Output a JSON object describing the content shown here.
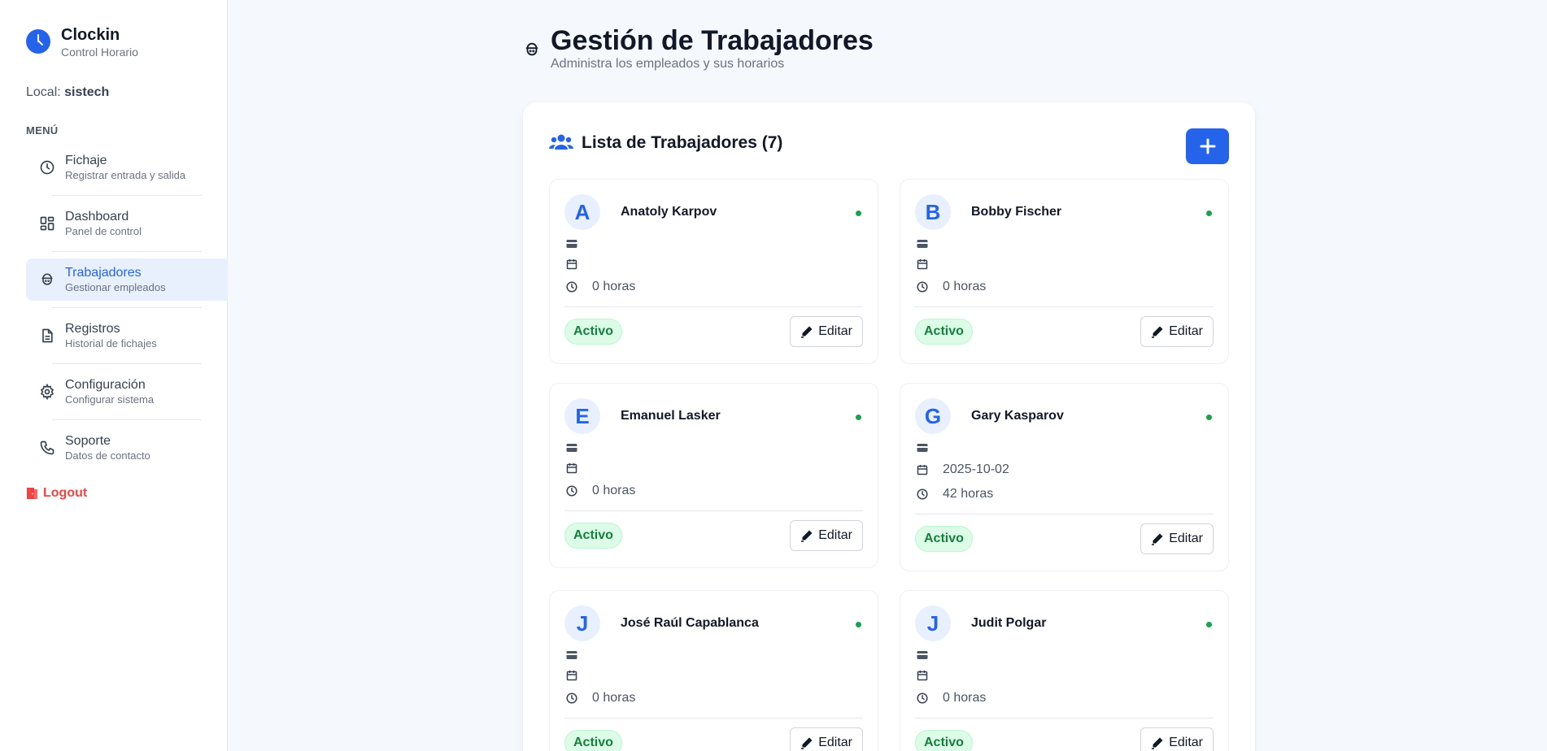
{
  "brand": {
    "title": "Clockin",
    "subtitle": "Control Horario"
  },
  "local": {
    "label": "Local:",
    "value": "sistech"
  },
  "menu_label": "MENÚ",
  "nav": [
    {
      "title": "Fichaje",
      "sub": "Registrar entrada y salida",
      "icon": "clock-icon"
    },
    {
      "title": "Dashboard",
      "sub": "Panel de control",
      "icon": "dashboard-icon"
    },
    {
      "title": "Trabajadores",
      "sub": "Gestionar empleados",
      "icon": "worker-icon",
      "active": true
    },
    {
      "title": "Registros",
      "sub": "Historial de fichajes",
      "icon": "document-icon"
    },
    {
      "title": "Configuración",
      "sub": "Configurar sistema",
      "icon": "gear-icon"
    },
    {
      "title": "Soporte",
      "sub": "Datos de contacto",
      "icon": "phone-icon"
    }
  ],
  "logout_label": "Logout",
  "header": {
    "title": "Gestión de Trabajadores",
    "subtitle": "Administra los empleados y sus horarios"
  },
  "panel": {
    "title": "Lista de Trabajadores (7)",
    "add_icon": "plus-icon"
  },
  "colors": {
    "accent": "#2563eb",
    "active_green": "#16a34a",
    "logout_red": "#ef4444"
  },
  "workers": [
    {
      "initial": "A",
      "name": "Anatoly Karpov",
      "card": "",
      "date": "",
      "hours": "0 horas",
      "status": "Activo",
      "edit": "Editar"
    },
    {
      "initial": "B",
      "name": "Bobby Fischer",
      "card": "",
      "date": "",
      "hours": "0 horas",
      "status": "Activo",
      "edit": "Editar"
    },
    {
      "initial": "E",
      "name": "Emanuel Lasker",
      "card": "",
      "date": "",
      "hours": "0 horas",
      "status": "Activo",
      "edit": "Editar"
    },
    {
      "initial": "G",
      "name": "Gary Kasparov",
      "card": "",
      "date": "2025-10-02",
      "hours": "42 horas",
      "status": "Activo",
      "edit": "Editar"
    },
    {
      "initial": "J",
      "name": "José Raúl Capablanca",
      "card": "",
      "date": "",
      "hours": "0 horas",
      "status": "Activo",
      "edit": "Editar"
    },
    {
      "initial": "J",
      "name": "Judit Polgar",
      "card": "",
      "date": "",
      "hours": "0 horas",
      "status": "Activo",
      "edit": "Editar"
    }
  ]
}
